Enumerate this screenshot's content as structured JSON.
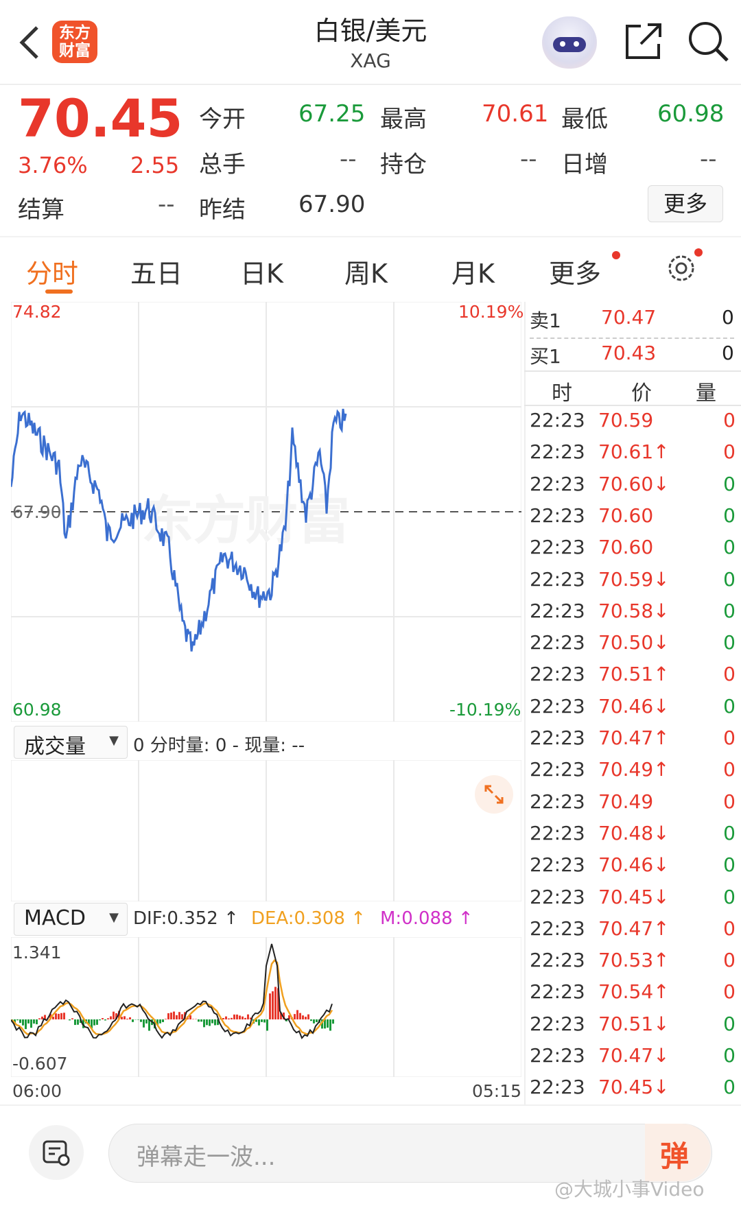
{
  "header": {
    "logo_text": "东方\n财富",
    "title": "白银/美元",
    "subtitle": "XAG",
    "share_icon": "share-icon",
    "search_icon": "search-icon"
  },
  "quote": {
    "price": "70.45",
    "change_pct": "3.76%",
    "change": "2.55",
    "open_label": "今开",
    "open": "67.25",
    "high_label": "最高",
    "high": "70.61",
    "low_label": "最低",
    "low": "60.98",
    "volume_label": "总手",
    "volume": "--",
    "oi_label": "持仓",
    "oi": "--",
    "daily_inc_label": "日增",
    "daily_inc": "--",
    "settle_label": "结算",
    "settle": "--",
    "prev_settle_label": "昨结",
    "prev_settle": "67.90",
    "more_button": "更多"
  },
  "tabs": [
    {
      "label": "分时",
      "active": true
    },
    {
      "label": "五日"
    },
    {
      "label": "日K"
    },
    {
      "label": "周K"
    },
    {
      "label": "月K"
    },
    {
      "label": "更多"
    }
  ],
  "chart_labels": {
    "top_price": "74.82",
    "top_pct": "10.19%",
    "bottom_price": "60.98",
    "bottom_pct": "-10.19%",
    "ref_price": "67.90",
    "watermark": "东方财富",
    "volume_selector": "成交量",
    "volume_info": "0 分时量: 0 - 现量: --",
    "macd_selector": "MACD",
    "dif": "DIF:0.352 ↑",
    "dea": "DEA:0.308 ↑",
    "m": "M:0.088 ↑",
    "macd_top": "1.341",
    "macd_bottom": "-0.607",
    "time_start": "06:00",
    "time_end": "05:15"
  },
  "order_book": {
    "sell_label": "卖1",
    "sell_price": "70.47",
    "sell_vol": "0",
    "buy_label": "买1",
    "buy_price": "70.43",
    "buy_vol": "0"
  },
  "trades_header": {
    "time": "时",
    "price": "价",
    "volume": "量"
  },
  "trades": [
    {
      "time": "22:23",
      "price": "70.59",
      "vol": "0",
      "dir": "",
      "pc": "red",
      "vc": "red"
    },
    {
      "time": "22:23",
      "price": "70.61↑",
      "vol": "0",
      "dir": "up",
      "pc": "red",
      "vc": "red"
    },
    {
      "time": "22:23",
      "price": "70.60↓",
      "vol": "0",
      "dir": "down",
      "pc": "red",
      "vc": "green"
    },
    {
      "time": "22:23",
      "price": "70.60",
      "vol": "0",
      "dir": "",
      "pc": "red",
      "vc": "green"
    },
    {
      "time": "22:23",
      "price": "70.60",
      "vol": "0",
      "dir": "",
      "pc": "red",
      "vc": "green"
    },
    {
      "time": "22:23",
      "price": "70.59↓",
      "vol": "0",
      "dir": "down",
      "pc": "red",
      "vc": "green"
    },
    {
      "time": "22:23",
      "price": "70.58↓",
      "vol": "0",
      "dir": "down",
      "pc": "red",
      "vc": "green"
    },
    {
      "time": "22:23",
      "price": "70.50↓",
      "vol": "0",
      "dir": "down",
      "pc": "red",
      "vc": "green"
    },
    {
      "time": "22:23",
      "price": "70.51↑",
      "vol": "0",
      "dir": "up",
      "pc": "red",
      "vc": "red"
    },
    {
      "time": "22:23",
      "price": "70.46↓",
      "vol": "0",
      "dir": "down",
      "pc": "red",
      "vc": "green"
    },
    {
      "time": "22:23",
      "price": "70.47↑",
      "vol": "0",
      "dir": "up",
      "pc": "red",
      "vc": "red"
    },
    {
      "time": "22:23",
      "price": "70.49↑",
      "vol": "0",
      "dir": "up",
      "pc": "red",
      "vc": "red"
    },
    {
      "time": "22:23",
      "price": "70.49",
      "vol": "0",
      "dir": "",
      "pc": "red",
      "vc": "red"
    },
    {
      "time": "22:23",
      "price": "70.48↓",
      "vol": "0",
      "dir": "down",
      "pc": "red",
      "vc": "green"
    },
    {
      "time": "22:23",
      "price": "70.46↓",
      "vol": "0",
      "dir": "down",
      "pc": "red",
      "vc": "green"
    },
    {
      "time": "22:23",
      "price": "70.45↓",
      "vol": "0",
      "dir": "down",
      "pc": "red",
      "vc": "green"
    },
    {
      "time": "22:23",
      "price": "70.47↑",
      "vol": "0",
      "dir": "up",
      "pc": "red",
      "vc": "red"
    },
    {
      "time": "22:23",
      "price": "70.53↑",
      "vol": "0",
      "dir": "up",
      "pc": "red",
      "vc": "red"
    },
    {
      "time": "22:23",
      "price": "70.54↑",
      "vol": "0",
      "dir": "up",
      "pc": "red",
      "vc": "red"
    },
    {
      "time": "22:23",
      "price": "70.51↓",
      "vol": "0",
      "dir": "down",
      "pc": "red",
      "vc": "green"
    },
    {
      "time": "22:23",
      "price": "70.47↓",
      "vol": "0",
      "dir": "down",
      "pc": "red",
      "vc": "green"
    },
    {
      "time": "22:23",
      "price": "70.45↓",
      "vol": "0",
      "dir": "down",
      "pc": "red",
      "vc": "green"
    }
  ],
  "bottom_bar": {
    "input_placeholder": "弹幕走一波...",
    "danmu_button": "弹",
    "watermark": "@大城小事Video"
  },
  "colors": {
    "up": "#e8372b",
    "down": "#1a9a3a",
    "accent": "#f07020",
    "line": "#3b6fd0"
  }
}
